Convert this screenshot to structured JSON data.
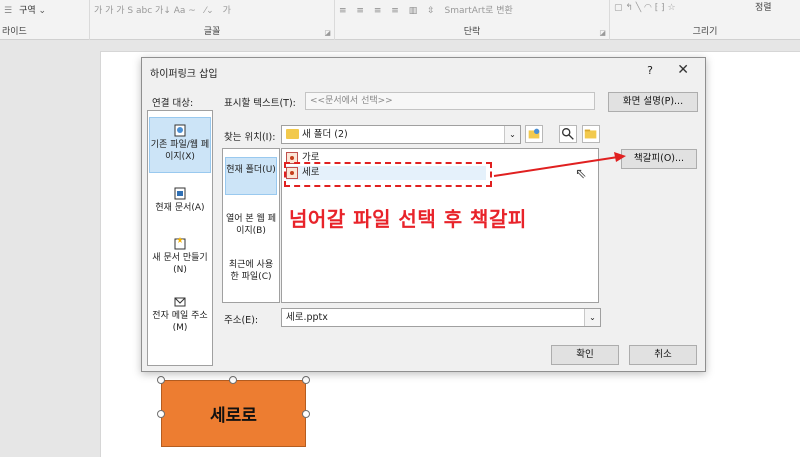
{
  "ribbon": {
    "section_label": "구역",
    "groups": [
      {
        "label": "라이드"
      },
      {
        "label": "글꼴"
      },
      {
        "label": "단락"
      },
      {
        "label": "그리기"
      }
    ],
    "smartart_label": "SmartArt로 변환",
    "arrange_label": "정렬",
    "font_glyphs": "가 가 가 S abc 가↓ Aa ~",
    "font_color_glyph": "가"
  },
  "slide_shape": {
    "text": "세로로",
    "fill": "#ed7d31"
  },
  "dialog": {
    "title": "하이퍼링크 삽입",
    "help": "?",
    "close": "✕",
    "link_target_label": "연결 대상:",
    "display_text_label": "표시할 텍스트(T):",
    "display_text_value": "<<문서에서 선택>>",
    "screen_tip_button": "화면 설명(P)...",
    "nav": [
      {
        "label": "기존 파일/웹 페이지(X)",
        "active": true,
        "icon": "existing-file-icon"
      },
      {
        "label": "현재 문서(A)",
        "active": false,
        "icon": "current-doc-icon"
      },
      {
        "label": "새 문서 만들기(N)",
        "active": false,
        "icon": "new-doc-icon"
      },
      {
        "label": "전자 메일 주소(M)",
        "active": false,
        "icon": "email-icon"
      }
    ],
    "look_in_label": "찾는 위치(I):",
    "look_in_value": "새 폴더 (2)",
    "subnav": [
      {
        "label": "현재 폴더(U)",
        "active": true
      },
      {
        "label": "열어 본 웹 페이지(B)",
        "active": false
      },
      {
        "label": "최근에 사용한 파일(C)",
        "active": false
      }
    ],
    "files": [
      {
        "name": "가로",
        "selected": false
      },
      {
        "name": "세로",
        "selected": true
      }
    ],
    "bookmark_button": "책갈피(O)...",
    "address_label": "주소(E):",
    "address_value": "세로.pptx",
    "ok_button": "확인",
    "cancel_button": "취소"
  },
  "annotation": {
    "text": "넘어갈 파일 선택 후 책갈피",
    "color": "#e8232a"
  }
}
